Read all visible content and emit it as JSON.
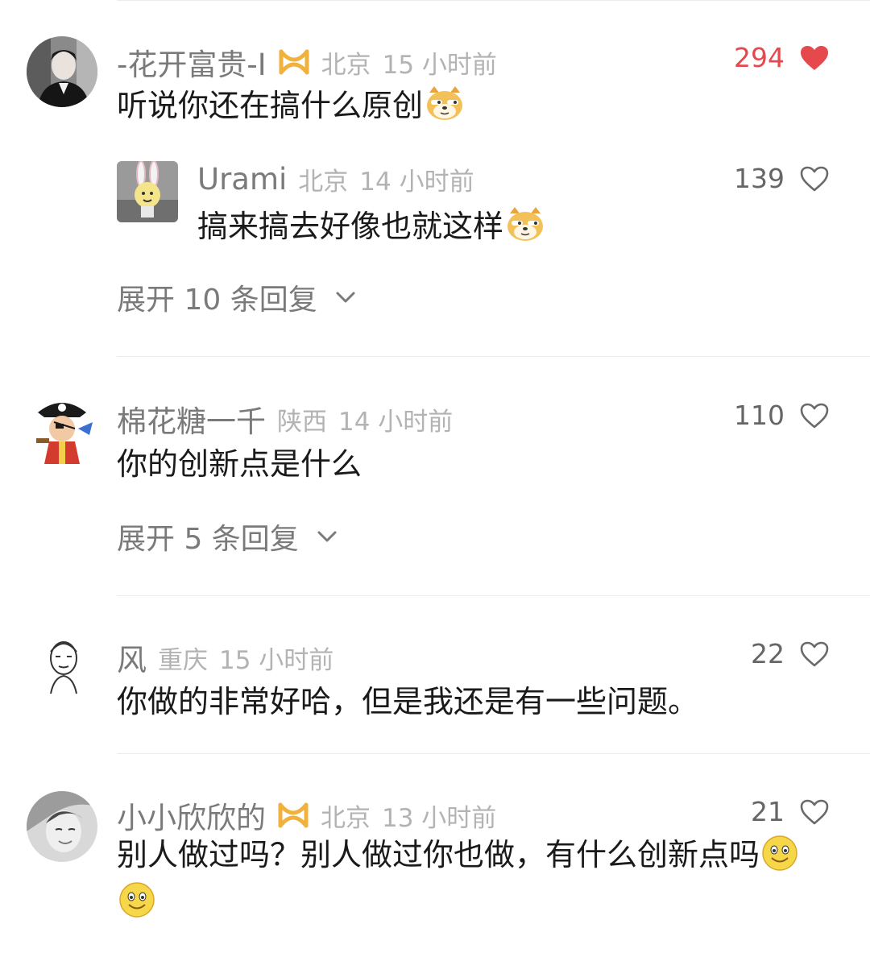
{
  "comments": [
    {
      "username": "-花开富贵-I",
      "location": "北京",
      "time": "15 小时前",
      "text": "听说你还在搞什么原创",
      "likes": "294",
      "liked": true,
      "emoji": "doge-emoji",
      "reply": {
        "username": "Urami",
        "location": "北京",
        "time": "14 小时前",
        "text": "搞来搞去好像也就这样",
        "likes": "139",
        "emoji": "doge-emoji"
      },
      "expand_label": "展开 10 条回复"
    },
    {
      "username": "棉花糖一千",
      "location": "陕西",
      "time": "14 小时前",
      "text": "你的创新点是什么",
      "likes": "110",
      "liked": false,
      "expand_label": "展开 5 条回复"
    },
    {
      "username": "风",
      "location": "重庆",
      "time": "15 小时前",
      "text": "你做的非常好哈，但是我还是有一些问题。",
      "likes": "22",
      "liked": false
    },
    {
      "username": "小小欣欣的",
      "location": "北京",
      "time": "13 小时前",
      "text": "别人做过吗？别人做过你也做，有什么创新点吗",
      "likes": "21",
      "liked": false,
      "emoji": "smile-emoji"
    }
  ],
  "colors": {
    "like_active": "#e5484d",
    "badge": "#f0b23c",
    "muted_text": "#7a7a7a",
    "meta_text": "#b3b3b3"
  }
}
